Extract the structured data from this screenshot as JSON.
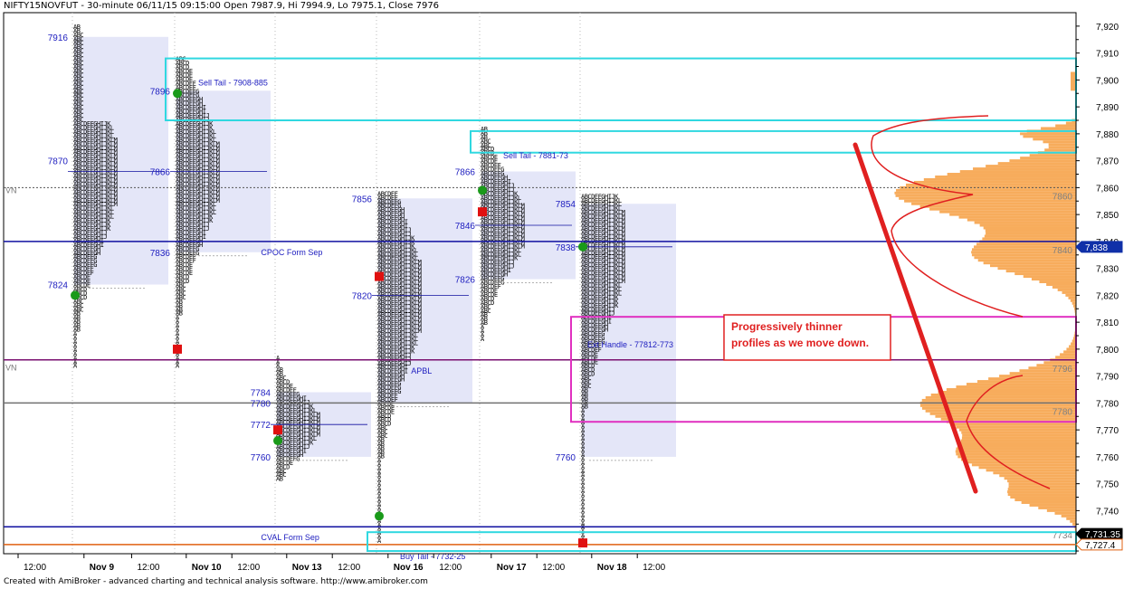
{
  "chart_title": "NIFTY15NOVFUT - 30-minute 06/11/15 09:15:00 Open 7987.9, Hi 7994.9, Lo 7975.1, Close 7976",
  "footer": "Created with AmiBroker - advanced charting and technical analysis software. http://www.amibroker.com",
  "colors": {
    "blue_text": "#2020c0",
    "profile_box": "#e4e6f8",
    "volume_profile": "#f7ac5c",
    "cyan_box": "#30d8e0",
    "magenta_box": "#e030c0",
    "navy_line": "#1010a0",
    "purple_line": "#7a1070",
    "gray_line": "#707070",
    "orange_line": "#e06010",
    "red_annot": "#e02020",
    "green_dot": "#1a9a1a",
    "red_square": "#e01010"
  },
  "chart_data": {
    "type": "market-profile",
    "ylim": [
      7724,
      7925
    ],
    "y_ticks": [
      7740,
      7750,
      7760,
      7770,
      7780,
      7790,
      7800,
      7810,
      7820,
      7830,
      7840,
      7850,
      7860,
      7870,
      7880,
      7890,
      7900,
      7910,
      7920
    ],
    "x_labels": [
      {
        "label": "12:00",
        "day": 0,
        "offset": -0.5
      },
      {
        "label": "Nov 9",
        "day": 0,
        "offset": 0.15
      },
      {
        "label": "12:00",
        "day": 0,
        "offset": 0.62
      },
      {
        "label": "Nov 10",
        "day": 1,
        "offset": 0.15
      },
      {
        "label": "12:00",
        "day": 1,
        "offset": 0.6
      },
      {
        "label": "Nov 13",
        "day": 2,
        "offset": 0.15
      },
      {
        "label": "12:00",
        "day": 2,
        "offset": 0.6
      },
      {
        "label": "Nov 16",
        "day": 3,
        "offset": 0.15
      },
      {
        "label": "12:00",
        "day": 3,
        "offset": 0.6
      },
      {
        "label": "Nov 17",
        "day": 4,
        "offset": 0.15
      },
      {
        "label": "12:00",
        "day": 4,
        "offset": 0.6
      },
      {
        "label": "Nov 18",
        "day": 5,
        "offset": 0.15
      },
      {
        "label": "12:00",
        "day": 5,
        "offset": 0.6
      }
    ],
    "days": [
      {
        "name": "Nov 9",
        "high": 7920,
        "low": 7793,
        "va_high": 7916,
        "va_low": 7824,
        "poc": 7866,
        "labels": [
          {
            "text": "7916",
            "y": 7916
          },
          {
            "text": "7870",
            "y": 7870
          },
          {
            "text": "7824",
            "y": 7824
          }
        ],
        "dots": [
          {
            "kind": "green",
            "y": 7820
          }
        ]
      },
      {
        "name": "Nov 10",
        "high": 7908,
        "low": 7794,
        "va_high": 7896,
        "va_low": 7836,
        "poc": 7866,
        "labels": [
          {
            "text": "7896",
            "y": 7896
          },
          {
            "text": "7866",
            "y": 7866
          },
          {
            "text": "7836",
            "y": 7836
          }
        ],
        "dots": [
          {
            "kind": "green",
            "y": 7895
          },
          {
            "kind": "red",
            "y": 7800
          }
        ]
      },
      {
        "name": "Nov 13",
        "high": 7797,
        "low": 7751,
        "va_high": 7784,
        "va_low": 7760,
        "poc": 7772,
        "labels": [
          {
            "text": "7784",
            "y": 7784
          },
          {
            "text": "7772",
            "y": 7772
          },
          {
            "text": "7760",
            "y": 7760
          },
          {
            "text": "7780",
            "y": 7780
          }
        ],
        "dots": [
          {
            "kind": "red",
            "y": 7770
          },
          {
            "kind": "green",
            "y": 7766
          }
        ]
      },
      {
        "name": "Nov 16",
        "high": 7858,
        "low": 7728,
        "va_high": 7856,
        "va_low": 7780,
        "poc": 7820,
        "labels": [
          {
            "text": "7856",
            "y": 7856
          },
          {
            "text": "7820",
            "y": 7820
          }
        ],
        "dots": [
          {
            "kind": "red",
            "y": 7827
          },
          {
            "kind": "green",
            "y": 7738
          }
        ]
      },
      {
        "name": "Nov 17",
        "high": 7882,
        "low": 7804,
        "va_high": 7866,
        "va_low": 7826,
        "poc": 7846,
        "labels": [
          {
            "text": "7866",
            "y": 7866
          },
          {
            "text": "7846",
            "y": 7846
          },
          {
            "text": "7826",
            "y": 7826
          }
        ],
        "dots": [
          {
            "kind": "green",
            "y": 7859
          },
          {
            "kind": "red",
            "y": 7851
          }
        ]
      },
      {
        "name": "Nov 18",
        "high": 7857,
        "low": 7728,
        "va_high": 7854,
        "va_low": 7760,
        "poc": 7838,
        "labels": [
          {
            "text": "7854",
            "y": 7854
          },
          {
            "text": "7838",
            "y": 7838
          },
          {
            "text": "7760",
            "y": 7760
          }
        ],
        "dots": [
          {
            "kind": "green",
            "y": 7838
          },
          {
            "kind": "red",
            "y": 7728
          }
        ]
      }
    ],
    "tpo_letters": "ABCDEFGHIJKLM",
    "hlines": [
      {
        "y": 7840,
        "kind": "navy",
        "label": "CPOC Form Sep",
        "label_x": 0.24,
        "right_label": "7840"
      },
      {
        "y": 7796,
        "kind": "purple",
        "label": "APBL",
        "label_x": 0.38,
        "right_label": "7796"
      },
      {
        "y": 7780,
        "kind": "gray",
        "label": "",
        "right_label": "7780"
      },
      {
        "y": 7734,
        "kind": "navy",
        "label": "CVAL Form Sep",
        "label_x": 0.24,
        "right_label": "7734"
      },
      {
        "y": 7727.4,
        "kind": "orange",
        "label": "",
        "right_label": ""
      },
      {
        "y": 7860,
        "kind": "dotted",
        "label": "",
        "right_label": "7860"
      }
    ],
    "zones": [
      {
        "kind": "cyan",
        "y1": 7908,
        "y2": 7885,
        "x_day": 1,
        "label": "Sell Tail - 7908-885"
      },
      {
        "kind": "cyan",
        "y1": 7881,
        "y2": 7873,
        "x_day": 4,
        "label": "Sell Tail - 7881-73"
      },
      {
        "kind": "magenta",
        "y1": 7812,
        "y2": 7773,
        "x_day": 5,
        "label": "Ext Handle - 77812-773"
      },
      {
        "kind": "cyan",
        "y1": 7732,
        "y2": 7725,
        "x_day": 3,
        "label": "Buy Tail - 7732-25"
      }
    ],
    "price_badges": [
      {
        "text": "7,838",
        "y": 7838,
        "style": "blue"
      },
      {
        "text": "7,731.35",
        "y": 7731.35,
        "style": "black"
      },
      {
        "text": "7,727.4",
        "y": 7727.4,
        "style": "orange"
      }
    ],
    "vn_labels": [
      {
        "text": "VN",
        "y": 7858
      },
      {
        "text": "VN",
        "y": 7792
      }
    ],
    "annotation": {
      "lines": [
        "Progressively thinner",
        "profiles as we move down."
      ]
    }
  }
}
